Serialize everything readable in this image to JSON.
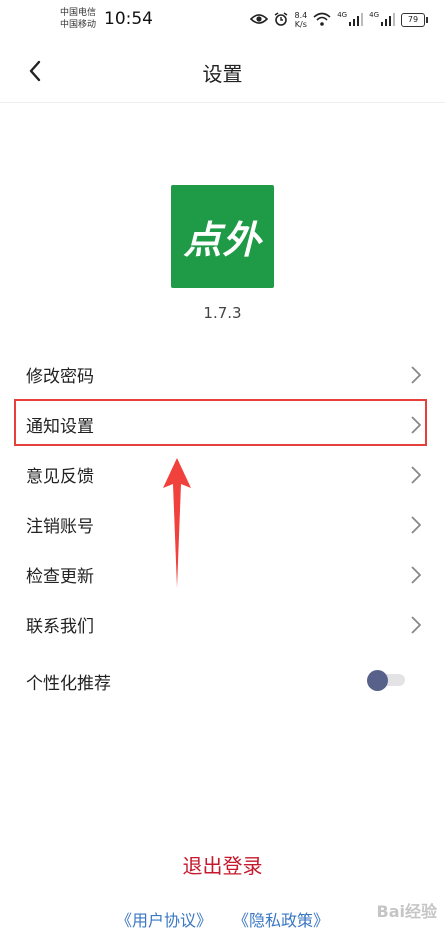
{
  "status_bar": {
    "carrier_1": "中国电信",
    "carrier_2": "中国移动",
    "time": "10:54",
    "speed_value": "8.4",
    "speed_unit": "K/s",
    "net_1": "4G",
    "net_2": "4G",
    "battery": "79"
  },
  "nav": {
    "title": "设置"
  },
  "app": {
    "icon_text": "点外",
    "version": "1.7.3",
    "brand_color": "#1f9a46"
  },
  "menu": {
    "items": [
      {
        "label": "修改密码"
      },
      {
        "label": "通知设置"
      },
      {
        "label": "意见反馈"
      },
      {
        "label": "注销账号"
      },
      {
        "label": "检查更新"
      },
      {
        "label": "联系我们"
      }
    ],
    "toggle_label": "个性化推荐",
    "toggle_on": false
  },
  "actions": {
    "logout": "退出登录",
    "user_agreement": "《用户协议》",
    "privacy_policy": "《隐私政策》"
  },
  "watermark": "Bai经验",
  "colors": {
    "highlight": "#e5403b",
    "logout": "#c5192d",
    "link": "#3a77c4",
    "toggle_knob": "#58618a"
  }
}
